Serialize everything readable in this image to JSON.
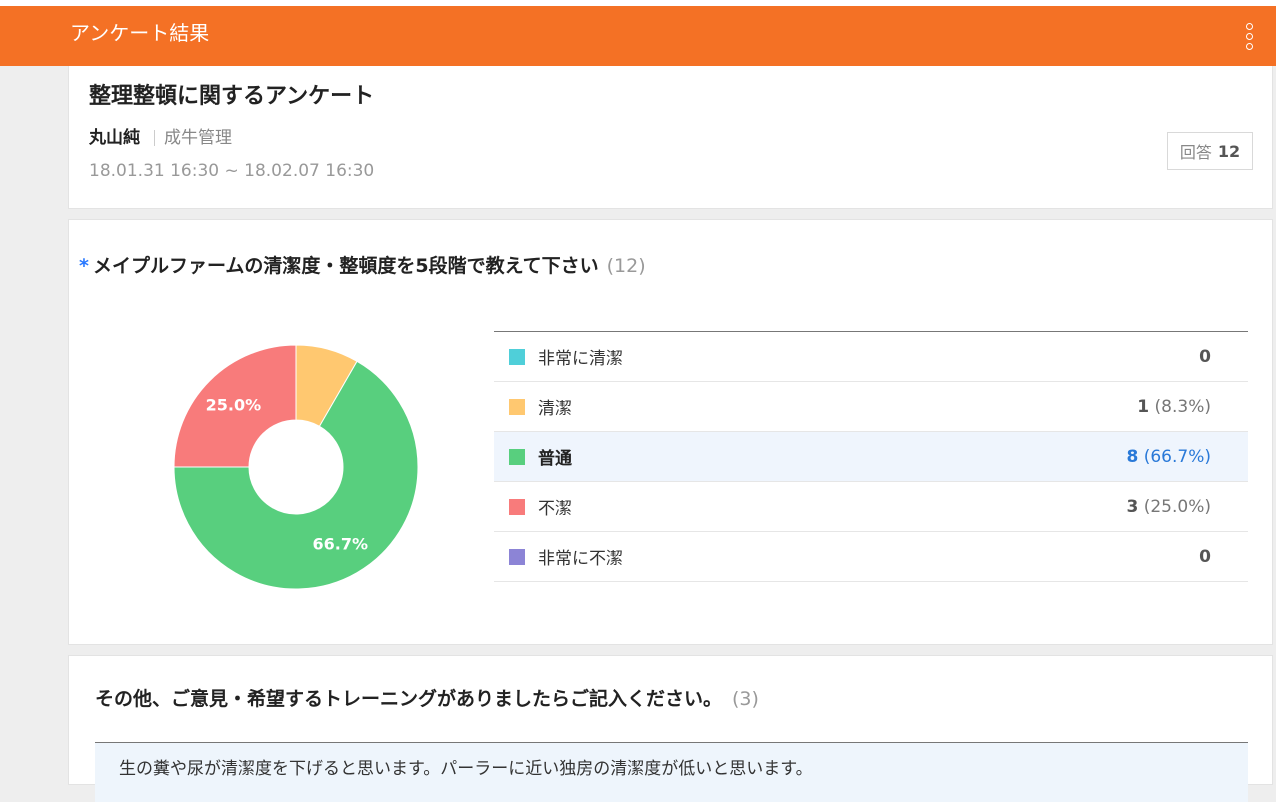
{
  "header": {
    "title": "アンケート結果",
    "menu_icon": "more-vertical-icon",
    "color": "#f47125"
  },
  "survey": {
    "title": "整理整頓に関するアンケート",
    "author": "丸山純",
    "department": "成牛管理",
    "period": "18.01.31 16:30 ~ 18.02.07 16:30",
    "responses_label": "回答",
    "responses_count": "12"
  },
  "question1": {
    "required_mark": "*",
    "title": "メイプルファームの清潔度・整頓度を5段階で教えて下さい",
    "count": "(12)",
    "options": [
      {
        "label": "非常に清潔",
        "count": "0",
        "percent": "",
        "color": "#4fcfd9"
      },
      {
        "label": "清潔",
        "count": "1",
        "percent": "(8.3%)",
        "color": "#ffc870"
      },
      {
        "label": "普通",
        "count": "8",
        "percent": "(66.7%)",
        "color": "#58cf7e"
      },
      {
        "label": "不潔",
        "count": "3",
        "percent": "(25.0%)",
        "color": "#f87b7b"
      },
      {
        "label": "非常に不潔",
        "count": "0",
        "percent": "",
        "color": "#8c84d6"
      }
    ],
    "selected_option": "普通"
  },
  "chart_data": {
    "type": "pie",
    "categories": [
      "非常に清潔",
      "清潔",
      "普通",
      "不潔",
      "非常に不潔"
    ],
    "values": [
      0,
      1,
      8,
      3,
      0
    ],
    "slice_labels": [
      "",
      "",
      "66.7%",
      "25.0%",
      ""
    ],
    "colors": [
      "#4fcfd9",
      "#ffc870",
      "#58cf7e",
      "#f87b7b",
      "#8c84d6"
    ],
    "donut": true
  },
  "question2": {
    "title": "その他、ご意見・希望するトレーニングがありましたらご記入ください。",
    "count": "(3)",
    "answers": [
      "生の糞や尿が清潔度を下げると思います。パーラーに近い独房の清潔度が低いと思います。"
    ]
  }
}
